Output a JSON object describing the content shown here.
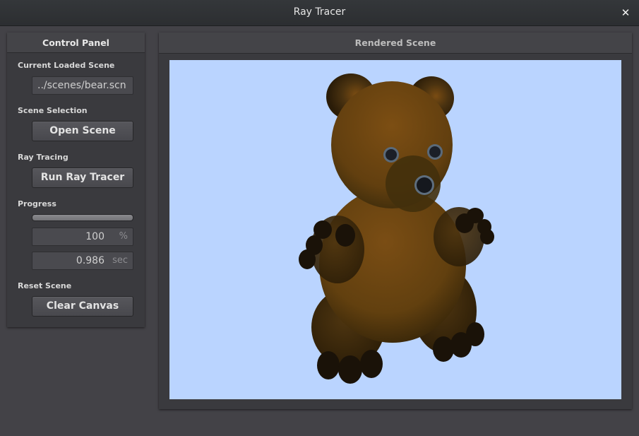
{
  "window": {
    "title": "Ray Tracer",
    "close_symbol": "✕"
  },
  "control_panel": {
    "header": "Control Panel",
    "current_scene_label": "Current Loaded Scene",
    "current_scene_value": "../scenes/bear.scn",
    "scene_selection_label": "Scene Selection",
    "open_scene_button": "Open Scene",
    "ray_tracing_label": "Ray Tracing",
    "run_button": "Run Ray Tracer",
    "progress_label": "Progress",
    "progress_fraction": 1.0,
    "progress_value": "100",
    "progress_unit": "%",
    "time_value": "0.986",
    "time_unit": "sec",
    "reset_label": "Reset Scene",
    "clear_button": "Clear Canvas"
  },
  "scene_panel": {
    "header": "Rendered Scene",
    "canvas_background": "#bad4ff",
    "bear_color": "#6b4210",
    "bear_dark": "#2a1a08"
  }
}
